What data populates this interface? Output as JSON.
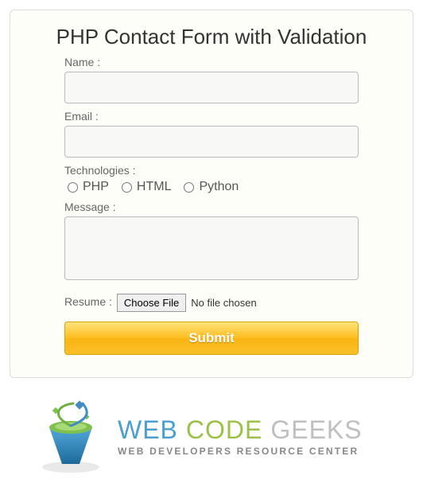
{
  "form": {
    "title": "PHP Contact Form with Validation",
    "name_label": "Name :",
    "email_label": "Email :",
    "tech_label": "Technologies :",
    "tech_options": {
      "php": "PHP",
      "html": "HTML",
      "python": "Python"
    },
    "message_label": "Message :",
    "resume_label": "Resume :",
    "file_button": "Choose File",
    "file_status": "No file chosen",
    "submit_label": "Submit"
  },
  "logo": {
    "word1": "WEB",
    "word2": "CODE",
    "word3": "GEEKS",
    "tagline": "WEB DEVELOPERS RESOURCE CENTER"
  }
}
